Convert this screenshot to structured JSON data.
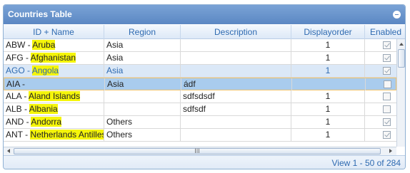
{
  "grid": {
    "title": "Countries Table",
    "columns": [
      "ID + Name",
      "Region",
      "Description",
      "Displayorder",
      "Enabled"
    ],
    "rows": [
      {
        "id": "ABW - ",
        "name": "Aruba",
        "region": "Asia",
        "description": "",
        "order": "1",
        "enabled": true,
        "state": ""
      },
      {
        "id": "AFG - ",
        "name": "Afghanistan",
        "region": "Asia",
        "description": "",
        "order": "1",
        "enabled": true,
        "state": ""
      },
      {
        "id": "AGO - ",
        "name": "Angola",
        "region": "Asia",
        "description": "",
        "order": "1",
        "enabled": true,
        "state": "hover"
      },
      {
        "id": "AIA - ",
        "name": "",
        "region": "Asia",
        "description": "ádf",
        "order": "",
        "enabled": false,
        "state": "selected"
      },
      {
        "id": "ALA - ",
        "name": "Aland Islands",
        "region": "",
        "description": "sdfsdsdf",
        "order": "1",
        "enabled": false,
        "state": ""
      },
      {
        "id": "ALB - ",
        "name": "Albania",
        "region": "",
        "description": "sdfsdf",
        "order": "1",
        "enabled": false,
        "state": ""
      },
      {
        "id": "AND - ",
        "name": "Andorra",
        "region": "Others",
        "description": "",
        "order": "1",
        "enabled": true,
        "state": ""
      },
      {
        "id": "ANT - ",
        "name": "Netherlands Antilles",
        "region": "Others",
        "description": "",
        "order": "1",
        "enabled": true,
        "state": ""
      }
    ],
    "footer": {
      "pager_text": "View 1 - 50 of 284"
    },
    "hscroll_grip": "III"
  }
}
